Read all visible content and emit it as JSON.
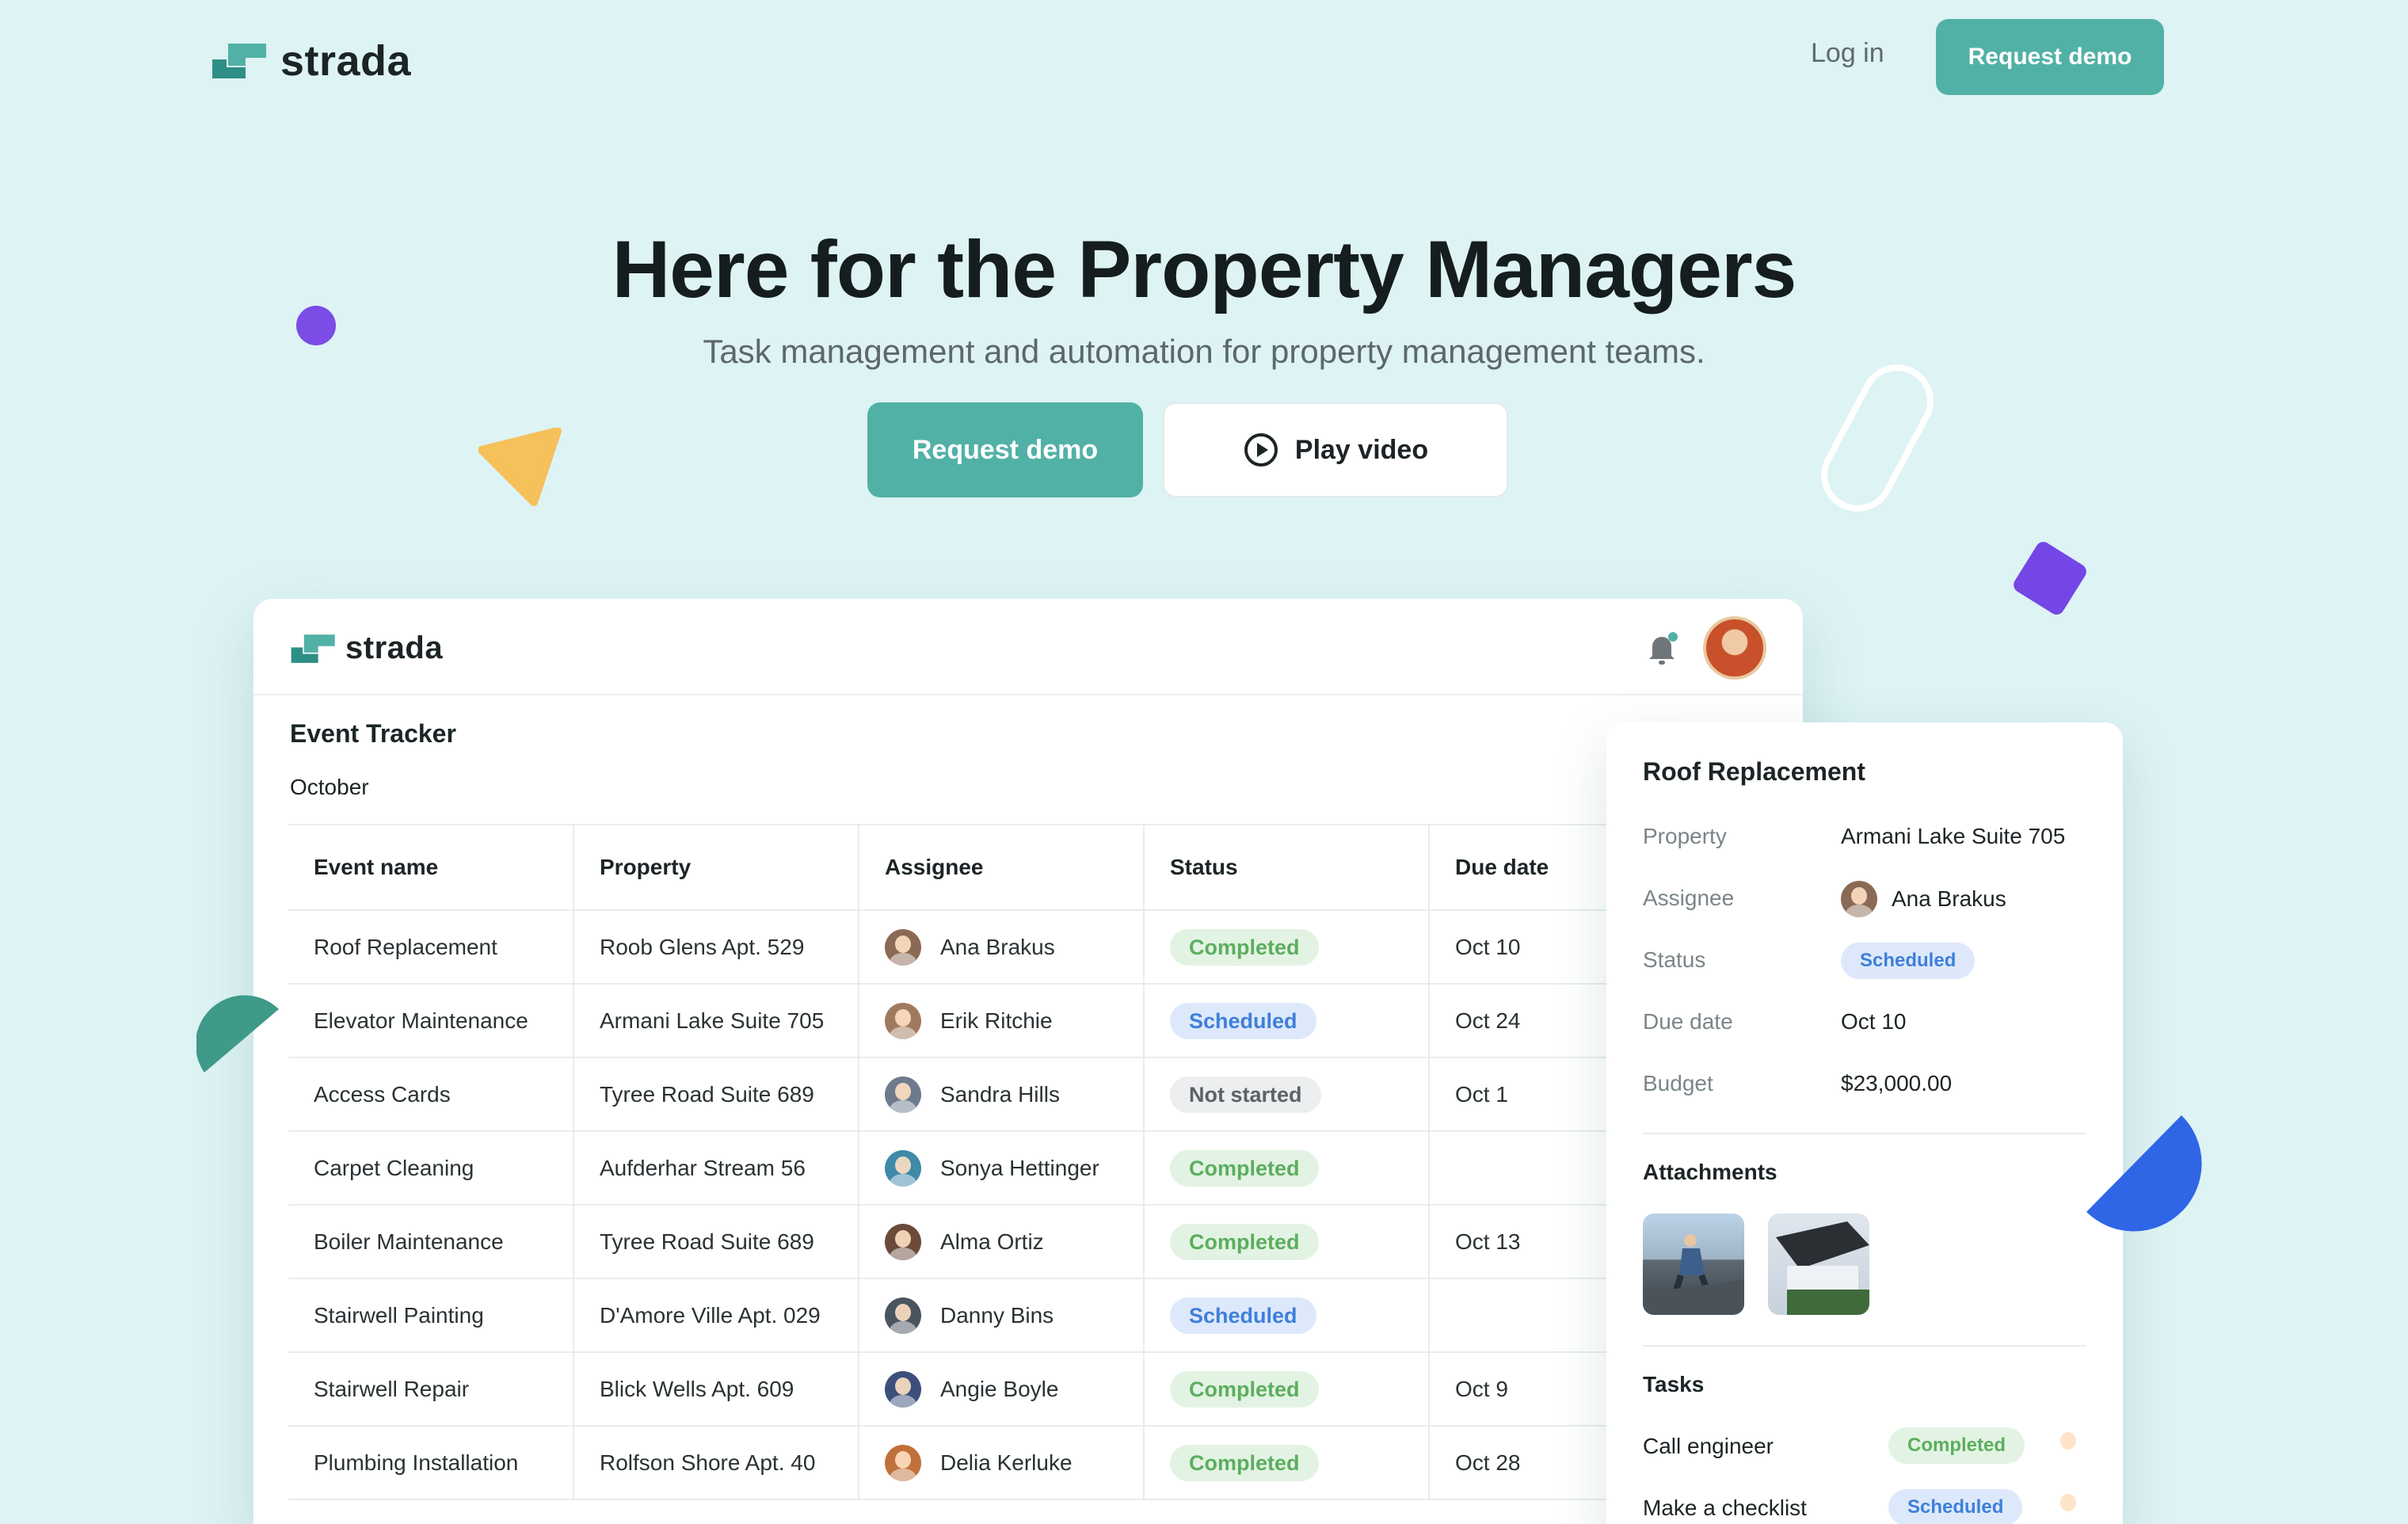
{
  "brand": {
    "name": "strada",
    "accent": "#52b1a6"
  },
  "nav": {
    "login_label": "Log in",
    "demo_label": "Request demo"
  },
  "hero": {
    "title": "Here for the Property Managers",
    "subtitle": "Task management and automation for property management teams.",
    "primary_cta": "Request demo",
    "secondary_cta": "Play video",
    "secondary_icon": "play-circle-icon"
  },
  "app": {
    "brand": "strada",
    "header_icons": [
      "bell-icon",
      "user-avatar"
    ],
    "tracker_title": "Event Tracker",
    "month": "October",
    "columns": [
      "Event name",
      "Property",
      "Assignee",
      "Status",
      "Due date"
    ],
    "rows": [
      {
        "event": "Roof Replacement",
        "property": "Roob Glens Apt. 529",
        "assignee": "Ana Brakus",
        "status": "Completed",
        "status_kind": "completed",
        "due": "Oct 10",
        "avatar_color": "#8b6a55"
      },
      {
        "event": "Elevator Maintenance",
        "property": "Armani Lake Suite 705",
        "assignee": "Erik Ritchie",
        "status": "Scheduled",
        "status_kind": "scheduled",
        "due": "Oct 24",
        "avatar_color": "#a07a5f"
      },
      {
        "event": "Access Cards",
        "property": "Tyree Road Suite 689",
        "assignee": "Sandra Hills",
        "status": "Not started",
        "status_kind": "notstarted",
        "due": "Oct 1",
        "avatar_color": "#6e7b8c"
      },
      {
        "event": "Carpet Cleaning",
        "property": "Aufderhar Stream 56",
        "assignee": "Sonya Hettinger",
        "status": "Completed",
        "status_kind": "completed",
        "due": "",
        "avatar_color": "#3f8aa8"
      },
      {
        "event": "Boiler Maintenance",
        "property": "Tyree Road Suite 689",
        "assignee": "Alma Ortiz",
        "status": "Completed",
        "status_kind": "completed",
        "due": "Oct 13",
        "avatar_color": "#6b4a3a"
      },
      {
        "event": "Stairwell Painting",
        "property": "D'Amore Ville Apt. 029",
        "assignee": "Danny Bins",
        "status": "Scheduled",
        "status_kind": "scheduled",
        "due": "",
        "avatar_color": "#4a5560"
      },
      {
        "event": "Stairwell Repair",
        "property": "Blick Wells Apt. 609",
        "assignee": "Angie Boyle",
        "status": "Completed",
        "status_kind": "completed",
        "due": "Oct 9",
        "avatar_color": "#3b4f7a"
      },
      {
        "event": "Plumbing Installation",
        "property": "Rolfson Shore Apt. 40",
        "assignee": "Delia Kerluke",
        "status": "Completed",
        "status_kind": "completed",
        "due": "Oct 28",
        "avatar_color": "#c0703a"
      }
    ]
  },
  "detail": {
    "title": "Roof Replacement",
    "fields": [
      {
        "label": "Property",
        "value": "Armani Lake Suite 705"
      },
      {
        "label": "Assignee",
        "value": "Ana Brakus"
      },
      {
        "label": "Status",
        "value": "Scheduled"
      },
      {
        "label": "Due date",
        "value": "Oct 10"
      },
      {
        "label": "Budget",
        "value": "$23,000.00"
      }
    ],
    "attachments_title": "Attachments",
    "tasks_title": "Tasks",
    "tasks": [
      {
        "label": "Call engineer",
        "status": "Completed",
        "status_kind": "completed"
      },
      {
        "label": "Make a checklist",
        "status": "Scheduled",
        "status_kind": "scheduled"
      }
    ]
  },
  "colors": {
    "background": "#def3f4",
    "completed_bg": "#e3f3e3",
    "completed_text": "#5cae5f",
    "scheduled_bg": "#dde9fb",
    "scheduled_text": "#3f7fd9",
    "notstarted_bg": "#eceeef",
    "notstarted_text": "#5b6366"
  }
}
